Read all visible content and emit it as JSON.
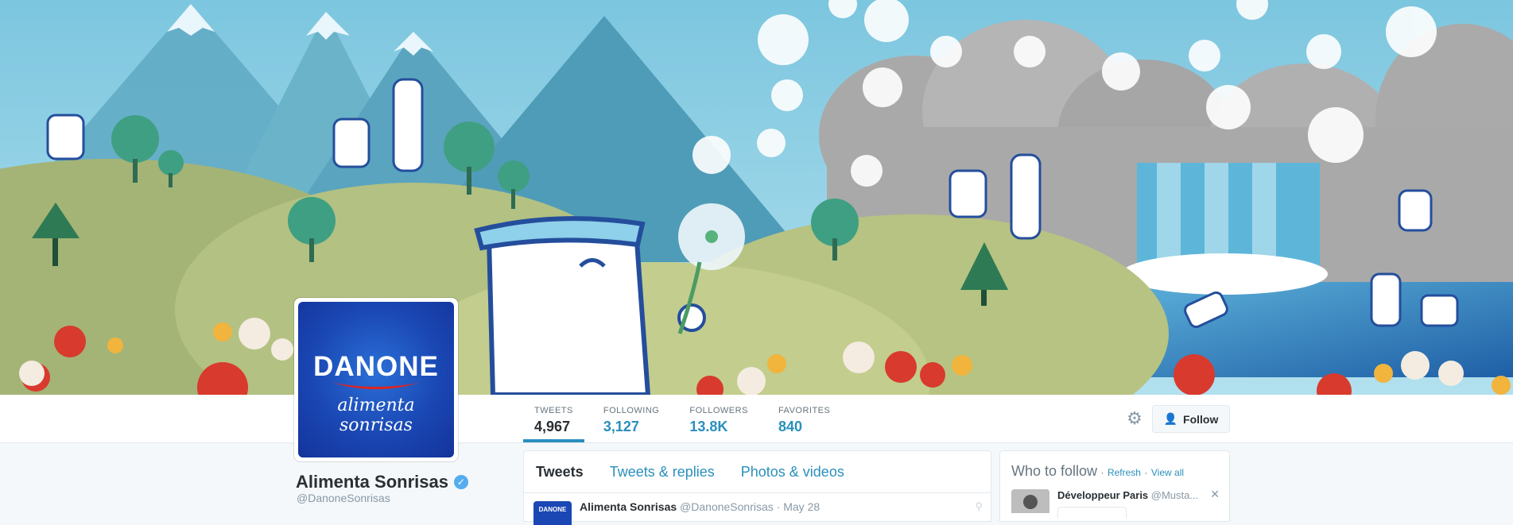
{
  "profile": {
    "name": "Alimenta Sonrisas",
    "handle": "@DanoneSonrisas",
    "avatar_brand": "DANONE",
    "avatar_tagline": "alimenta sonrisas"
  },
  "stats": [
    {
      "label": "TWEETS",
      "value": "4,967"
    },
    {
      "label": "FOLLOWING",
      "value": "3,127"
    },
    {
      "label": "FOLLOWERS",
      "value": "13.8K"
    },
    {
      "label": "FAVORITES",
      "value": "840"
    }
  ],
  "actions": {
    "follow_label": "Follow"
  },
  "timeline": {
    "tabs": [
      "Tweets",
      "Tweets & replies",
      "Photos & videos"
    ],
    "tweet": {
      "author": "Alimenta Sonrisas",
      "handle": "@DanoneSonrisas",
      "date": "May 28",
      "avatar_text": "DANONE"
    }
  },
  "who_to_follow": {
    "title": "Who to follow",
    "refresh": "Refresh",
    "view_all": "View all",
    "separator": "·",
    "user": {
      "name": "Développeur Paris",
      "handle": "@Musta..."
    }
  },
  "colors": {
    "accent": "#2a8fbd",
    "brand_blue": "#1a47b4",
    "sky": "#8ccfe4",
    "hills": "#a8b97a"
  }
}
